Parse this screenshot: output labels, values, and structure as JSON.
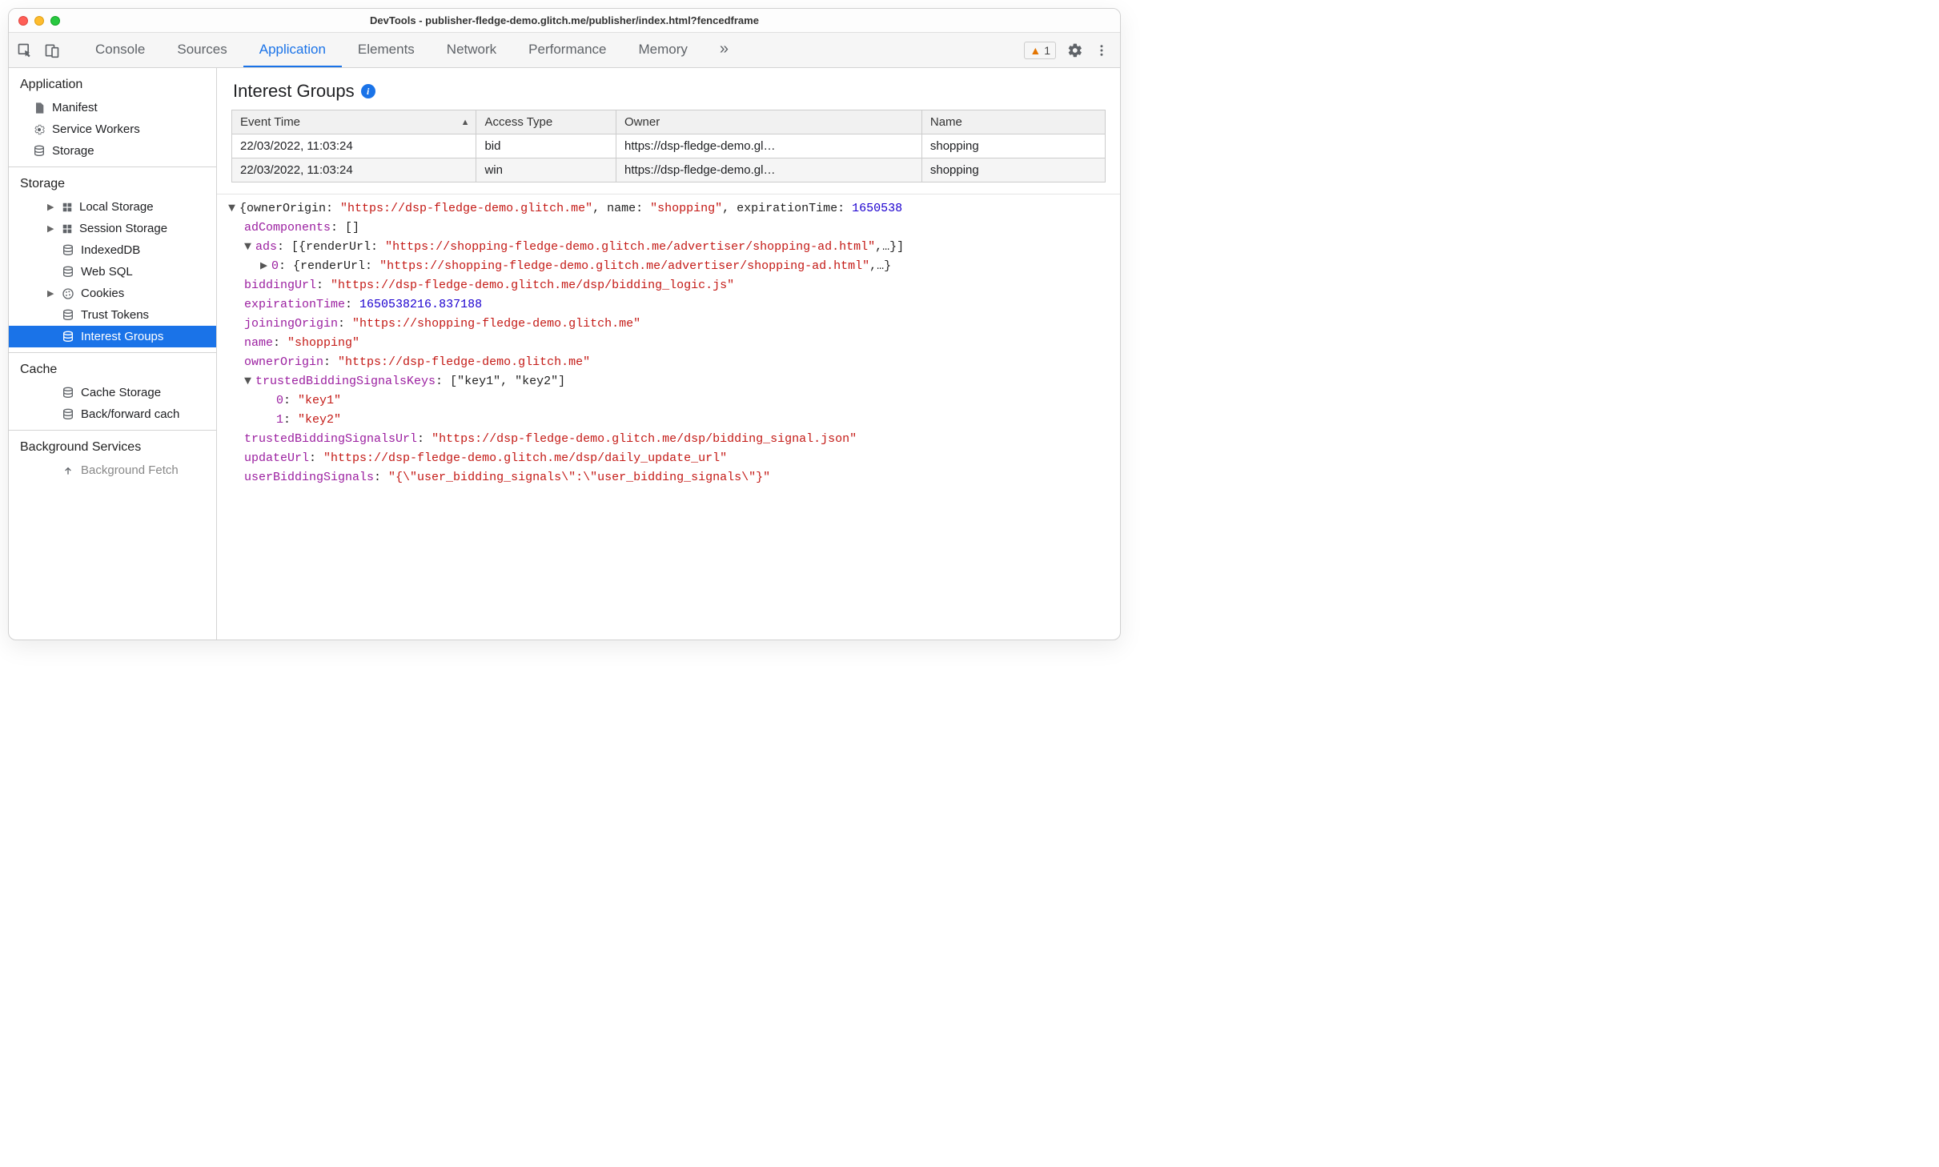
{
  "window": {
    "title": "DevTools - publisher-fledge-demo.glitch.me/publisher/index.html?fencedframe"
  },
  "tabs": {
    "items": [
      "Console",
      "Sources",
      "Application",
      "Elements",
      "Network",
      "Performance",
      "Memory"
    ],
    "active": "Application",
    "overflow": "»",
    "warning_count": "1"
  },
  "sidebar": {
    "groups": [
      {
        "header": "Application",
        "items": [
          {
            "icon": "file",
            "label": "Manifest"
          },
          {
            "icon": "gear",
            "label": "Service Workers"
          },
          {
            "icon": "db",
            "label": "Storage"
          }
        ]
      },
      {
        "header": "Storage",
        "items": [
          {
            "arrow": "▶",
            "icon": "grid",
            "label": "Local Storage"
          },
          {
            "arrow": "▶",
            "icon": "grid",
            "label": "Session Storage"
          },
          {
            "icon": "db",
            "label": "IndexedDB"
          },
          {
            "icon": "db",
            "label": "Web SQL"
          },
          {
            "arrow": "▶",
            "icon": "cookie",
            "label": "Cookies"
          },
          {
            "icon": "db",
            "label": "Trust Tokens"
          },
          {
            "icon": "db",
            "label": "Interest Groups",
            "selected": true
          }
        ]
      },
      {
        "header": "Cache",
        "items": [
          {
            "icon": "db",
            "label": "Cache Storage"
          },
          {
            "icon": "db",
            "label": "Back/forward cach"
          }
        ]
      },
      {
        "header": "Background Services",
        "items": [
          {
            "icon": "up",
            "label": "Background Fetch",
            "dim": true
          }
        ]
      }
    ]
  },
  "panel": {
    "title": "Interest Groups",
    "columns": {
      "time": "Event Time",
      "type": "Access Type",
      "owner": "Owner",
      "name": "Name"
    },
    "rows": [
      {
        "time": "22/03/2022, 11:03:24",
        "type": "bid",
        "owner": "https://dsp-fledge-demo.gl…",
        "name": "shopping"
      },
      {
        "time": "22/03/2022, 11:03:24",
        "type": "win",
        "owner": "https://dsp-fledge-demo.gl…",
        "name": "shopping"
      }
    ]
  },
  "detail": {
    "root_summary_pre": "{ownerOrigin: ",
    "root_summary_owner": "\"https://dsp-fledge-demo.glitch.me\"",
    "root_summary_mid1": ", name: ",
    "root_summary_name": "\"shopping\"",
    "root_summary_mid2": ", expirationTime: ",
    "root_summary_exp": "1650538",
    "adComponents_key": "adComponents",
    "adComponents_val": "[]",
    "ads_key": "ads",
    "ads_val_pre": "[{renderUrl: ",
    "ads_val_url": "\"https://shopping-fledge-demo.glitch.me/advertiser/shopping-ad.html\"",
    "ads_val_post": ",…}]",
    "ads0_key": "0",
    "ads0_val_pre": "{renderUrl: ",
    "ads0_val_url": "\"https://shopping-fledge-demo.glitch.me/advertiser/shopping-ad.html\"",
    "ads0_val_post": ",…}",
    "biddingUrl_key": "biddingUrl",
    "biddingUrl_val": "\"https://dsp-fledge-demo.glitch.me/dsp/bidding_logic.js\"",
    "expirationTime_key": "expirationTime",
    "expirationTime_val": "1650538216.837188",
    "joiningOrigin_key": "joiningOrigin",
    "joiningOrigin_val": "\"https://shopping-fledge-demo.glitch.me\"",
    "name_key": "name",
    "name_val": "\"shopping\"",
    "ownerOrigin_key": "ownerOrigin",
    "ownerOrigin_val": "\"https://dsp-fledge-demo.glitch.me\"",
    "tbsk_key": "trustedBiddingSignalsKeys",
    "tbsk_val": "[\"key1\", \"key2\"]",
    "tbsk0_key": "0",
    "tbsk0_val": "\"key1\"",
    "tbsk1_key": "1",
    "tbsk1_val": "\"key2\"",
    "tbsu_key": "trustedBiddingSignalsUrl",
    "tbsu_val": "\"https://dsp-fledge-demo.glitch.me/dsp/bidding_signal.json\"",
    "updateUrl_key": "updateUrl",
    "updateUrl_val": "\"https://dsp-fledge-demo.glitch.me/dsp/daily_update_url\"",
    "ubs_key": "userBiddingSignals",
    "ubs_val": "\"{\\\"user_bidding_signals\\\":\\\"user_bidding_signals\\\"}\""
  }
}
